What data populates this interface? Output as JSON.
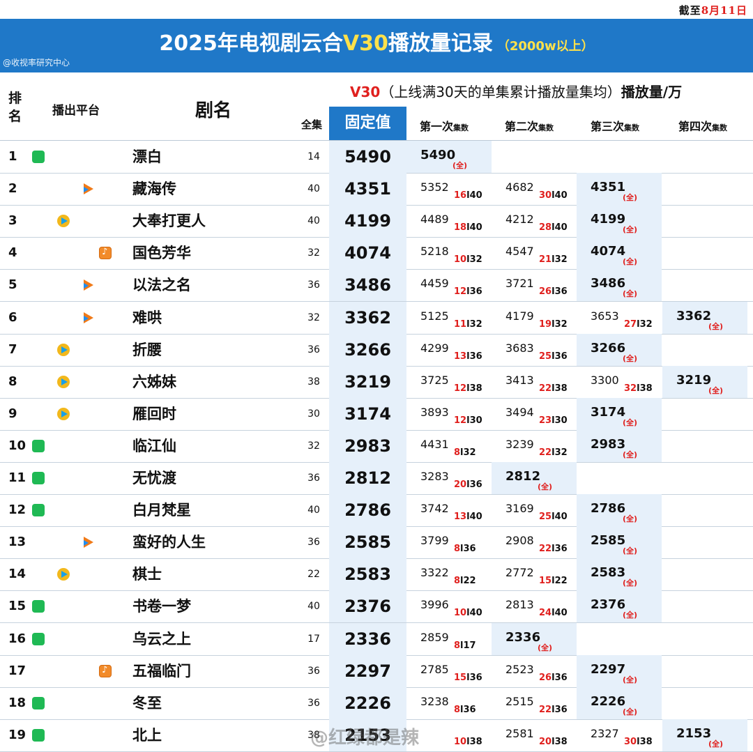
{
  "as_of": {
    "prefix": "截至",
    "date": "8月11日"
  },
  "title": {
    "part1": "2025年电视剧云合",
    "highlight": "V30",
    "part2": "播放量记录",
    "subtitle": "（2000w以上）"
  },
  "credit": "@收视率研究中心",
  "headers": {
    "rank": "排名",
    "platform": "播出平台",
    "name": "剧名",
    "episodes": "全集",
    "fixed": "固定值",
    "v30_label": "V30",
    "v30_desc": "（上线满30天的单集累计播放量集均）",
    "unit": "播放量/万",
    "rounds": [
      {
        "label": "第一次",
        "tag": "集数"
      },
      {
        "label": "第二次",
        "tag": "集数"
      },
      {
        "label": "第三次",
        "tag": "集数"
      },
      {
        "label": "第四次",
        "tag": "集数"
      }
    ]
  },
  "full_mark": "(全)",
  "rows": [
    {
      "rank": "1",
      "platform": "iqiyi",
      "name": "漂白",
      "eps": "14",
      "fixed": "5490",
      "rounds": [
        {
          "v": "5490",
          "final": true
        }
      ]
    },
    {
      "rank": "2",
      "platform": "youku",
      "name": "藏海传",
      "eps": "40",
      "fixed": "4351",
      "rounds": [
        {
          "v": "5352",
          "a": "16",
          "b": "40"
        },
        {
          "v": "4682",
          "a": "30",
          "b": "40"
        },
        {
          "v": "4351",
          "final": true
        }
      ]
    },
    {
      "rank": "3",
      "platform": "tencent",
      "name": "大奉打更人",
      "eps": "40",
      "fixed": "4199",
      "rounds": [
        {
          "v": "4489",
          "a": "18",
          "b": "40"
        },
        {
          "v": "4212",
          "a": "28",
          "b": "40"
        },
        {
          "v": "4199",
          "final": true
        }
      ]
    },
    {
      "rank": "4",
      "platform": "mango",
      "name": "国色芳华",
      "eps": "32",
      "fixed": "4074",
      "rounds": [
        {
          "v": "5218",
          "a": "10",
          "b": "32"
        },
        {
          "v": "4547",
          "a": "21",
          "b": "32"
        },
        {
          "v": "4074",
          "final": true
        }
      ]
    },
    {
      "rank": "5",
      "platform": "youku",
      "name": "以法之名",
      "eps": "36",
      "fixed": "3486",
      "rounds": [
        {
          "v": "4459",
          "a": "12",
          "b": "36"
        },
        {
          "v": "3721",
          "a": "26",
          "b": "36"
        },
        {
          "v": "3486",
          "final": true
        }
      ]
    },
    {
      "rank": "6",
      "platform": "youku",
      "name": "难哄",
      "eps": "32",
      "fixed": "3362",
      "rounds": [
        {
          "v": "5125",
          "a": "11",
          "b": "32"
        },
        {
          "v": "4179",
          "a": "19",
          "b": "32"
        },
        {
          "v": "3653",
          "a": "27",
          "b": "32"
        },
        {
          "v": "3362",
          "final": true
        }
      ]
    },
    {
      "rank": "7",
      "platform": "tencent",
      "name": "折腰",
      "eps": "36",
      "fixed": "3266",
      "rounds": [
        {
          "v": "4299",
          "a": "13",
          "b": "36"
        },
        {
          "v": "3683",
          "a": "25",
          "b": "36"
        },
        {
          "v": "3266",
          "final": true
        }
      ]
    },
    {
      "rank": "8",
      "platform": "tencent",
      "name": "六姊妹",
      "eps": "38",
      "fixed": "3219",
      "rounds": [
        {
          "v": "3725",
          "a": "12",
          "b": "38"
        },
        {
          "v": "3413",
          "a": "22",
          "b": "38"
        },
        {
          "v": "3300",
          "a": "32",
          "b": "38"
        },
        {
          "v": "3219",
          "final": true
        }
      ]
    },
    {
      "rank": "9",
      "platform": "tencent",
      "name": "雁回时",
      "eps": "30",
      "fixed": "3174",
      "rounds": [
        {
          "v": "3893",
          "a": "12",
          "b": "30"
        },
        {
          "v": "3494",
          "a": "23",
          "b": "30"
        },
        {
          "v": "3174",
          "final": true
        }
      ]
    },
    {
      "rank": "10",
      "platform": "iqiyi",
      "name": "临江仙",
      "eps": "32",
      "fixed": "2983",
      "rounds": [
        {
          "v": "4431",
          "a": "8",
          "b": "32"
        },
        {
          "v": "3239",
          "a": "22",
          "b": "32"
        },
        {
          "v": "2983",
          "final": true
        }
      ]
    },
    {
      "rank": "11",
      "platform": "iqiyi",
      "name": "无忧渡",
      "eps": "36",
      "fixed": "2812",
      "rounds": [
        {
          "v": "3283",
          "a": "20",
          "b": "36"
        },
        {
          "v": "2812",
          "final": true
        }
      ]
    },
    {
      "rank": "12",
      "platform": "iqiyi",
      "name": "白月梵星",
      "eps": "40",
      "fixed": "2786",
      "rounds": [
        {
          "v": "3742",
          "a": "13",
          "b": "40"
        },
        {
          "v": "3169",
          "a": "25",
          "b": "40"
        },
        {
          "v": "2786",
          "final": true
        }
      ]
    },
    {
      "rank": "13",
      "platform": "youku",
      "name": "蛮好的人生",
      "eps": "36",
      "fixed": "2585",
      "rounds": [
        {
          "v": "3799",
          "a": "8",
          "b": "36"
        },
        {
          "v": "2908",
          "a": "22",
          "b": "36"
        },
        {
          "v": "2585",
          "final": true
        }
      ]
    },
    {
      "rank": "14",
      "platform": "tencent",
      "name": "棋士",
      "eps": "22",
      "fixed": "2583",
      "rounds": [
        {
          "v": "3322",
          "a": "8",
          "b": "22"
        },
        {
          "v": "2772",
          "a": "15",
          "b": "22"
        },
        {
          "v": "2583",
          "final": true
        }
      ]
    },
    {
      "rank": "15",
      "platform": "iqiyi",
      "name": "书卷一梦",
      "eps": "40",
      "fixed": "2376",
      "rounds": [
        {
          "v": "3996",
          "a": "10",
          "b": "40"
        },
        {
          "v": "2813",
          "a": "24",
          "b": "40"
        },
        {
          "v": "2376",
          "final": true
        }
      ]
    },
    {
      "rank": "16",
      "platform": "iqiyi",
      "name": "乌云之上",
      "eps": "17",
      "fixed": "2336",
      "rounds": [
        {
          "v": "2859",
          "a": "8",
          "b": "17"
        },
        {
          "v": "2336",
          "final": true
        }
      ]
    },
    {
      "rank": "17",
      "platform": "mango",
      "name": "五福临门",
      "eps": "36",
      "fixed": "2297",
      "rounds": [
        {
          "v": "2785",
          "a": "15",
          "b": "36"
        },
        {
          "v": "2523",
          "a": "26",
          "b": "36"
        },
        {
          "v": "2297",
          "final": true
        }
      ]
    },
    {
      "rank": "18",
      "platform": "iqiyi",
      "name": "冬至",
      "eps": "36",
      "fixed": "2226",
      "rounds": [
        {
          "v": "3238",
          "a": "8",
          "b": "36"
        },
        {
          "v": "2515",
          "a": "22",
          "b": "36"
        },
        {
          "v": "2226",
          "final": true
        }
      ]
    },
    {
      "rank": "19",
      "platform": "iqiyi",
      "name": "北上",
      "eps": "38",
      "fixed": "2153",
      "rounds": [
        {
          "v": "",
          "a": "10",
          "b": "38"
        },
        {
          "v": "2581",
          "a": "20",
          "b": "38"
        },
        {
          "v": "2327",
          "a": "30",
          "b": "38"
        },
        {
          "v": "2153",
          "final": true
        }
      ]
    }
  ],
  "watermark": "@红绿都是辣"
}
